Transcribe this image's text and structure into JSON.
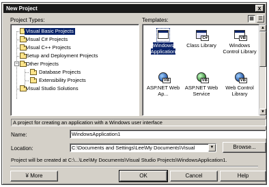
{
  "window": {
    "title": "New Project",
    "close_glyph": "x"
  },
  "project_types": {
    "label": "Project Types:",
    "items": [
      {
        "label": "Visual Basic Projects",
        "selected": true
      },
      {
        "label": "Visual C# Projects"
      },
      {
        "label": "Visual C++ Projects"
      },
      {
        "label": "Setup and Deployment Projects"
      },
      {
        "label": "Other Projects",
        "expanded": true
      },
      {
        "label": "Database Projects"
      },
      {
        "label": "Extensibility Projects"
      },
      {
        "label": "Visual Studio Solutions"
      }
    ]
  },
  "templates": {
    "label": "Templates:",
    "items": [
      {
        "label": "Windows Application",
        "icon": "windows-app-icon",
        "selected": true
      },
      {
        "label": "Class Library",
        "icon": "class-library-icon"
      },
      {
        "label": "Windows Control Library",
        "icon": "control-library-icon"
      },
      {
        "label": "ASP.NET Web Ap...",
        "icon": "aspnet-web-app-icon"
      },
      {
        "label": "ASP.NET Web Service",
        "icon": "aspnet-web-service-icon"
      },
      {
        "label": "Web Control Library",
        "icon": "web-control-library-icon"
      }
    ],
    "view_large_icon": "large-icons-view-icon",
    "view_small_icon": "list-view-icon"
  },
  "description": "A project for creating an application with a Windows user interface",
  "name_field": {
    "label": "Name:",
    "value": "WindowsApplication1"
  },
  "location_field": {
    "label": "Location:",
    "value": "C:\\Documents and Settings\\Lee\\My Documents\\Visual",
    "browse_label": "Browse..."
  },
  "create_path_note": "Project will be created at C:\\...\\Lee\\My Documents\\Visual Studio Projects\\WindowsApplication1.",
  "buttons": {
    "more": "¥ More",
    "ok": "OK",
    "cancel": "Cancel",
    "help": "Help"
  }
}
